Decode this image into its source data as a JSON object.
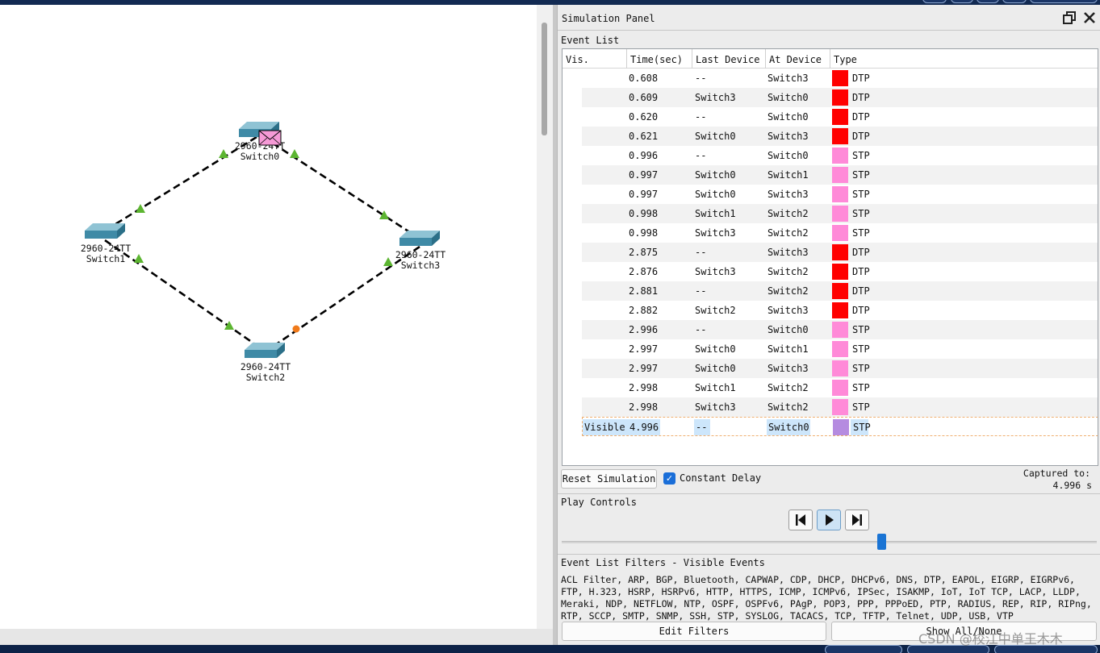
{
  "topology": {
    "devices": [
      {
        "model": "2960-24TT",
        "name": "Switch0"
      },
      {
        "model": "2960-24TT",
        "name": "Switch1"
      },
      {
        "model": "2960-24TT",
        "name": "Switch2"
      },
      {
        "model": "2960-24TT",
        "name": "Switch3"
      }
    ]
  },
  "panel": {
    "title": "Simulation Panel",
    "event_list_label": "Event List",
    "columns": [
      "Vis.",
      "Time(sec)",
      "Last Device",
      "At Device",
      "Type"
    ],
    "events": [
      {
        "time": "0.608",
        "last": "--",
        "at": "Switch3",
        "type": "DTP",
        "color": "#ff0000"
      },
      {
        "time": "0.609",
        "last": "Switch3",
        "at": "Switch0",
        "type": "DTP",
        "color": "#ff0000"
      },
      {
        "time": "0.620",
        "last": "--",
        "at": "Switch0",
        "type": "DTP",
        "color": "#ff0000"
      },
      {
        "time": "0.621",
        "last": "Switch0",
        "at": "Switch3",
        "type": "DTP",
        "color": "#ff0000"
      },
      {
        "time": "0.996",
        "last": "--",
        "at": "Switch0",
        "type": "STP",
        "color": "#ff8ad8"
      },
      {
        "time": "0.997",
        "last": "Switch0",
        "at": "Switch1",
        "type": "STP",
        "color": "#ff8ad8"
      },
      {
        "time": "0.997",
        "last": "Switch0",
        "at": "Switch3",
        "type": "STP",
        "color": "#ff8ad8"
      },
      {
        "time": "0.998",
        "last": "Switch1",
        "at": "Switch2",
        "type": "STP",
        "color": "#ff8ad8"
      },
      {
        "time": "0.998",
        "last": "Switch3",
        "at": "Switch2",
        "type": "STP",
        "color": "#ff8ad8"
      },
      {
        "time": "2.875",
        "last": "--",
        "at": "Switch3",
        "type": "DTP",
        "color": "#ff0000"
      },
      {
        "time": "2.876",
        "last": "Switch3",
        "at": "Switch2",
        "type": "DTP",
        "color": "#ff0000"
      },
      {
        "time": "2.881",
        "last": "--",
        "at": "Switch2",
        "type": "DTP",
        "color": "#ff0000"
      },
      {
        "time": "2.882",
        "last": "Switch2",
        "at": "Switch3",
        "type": "DTP",
        "color": "#ff0000"
      },
      {
        "time": "2.996",
        "last": "--",
        "at": "Switch0",
        "type": "STP",
        "color": "#ff8ad8"
      },
      {
        "time": "2.997",
        "last": "Switch0",
        "at": "Switch1",
        "type": "STP",
        "color": "#ff8ad8"
      },
      {
        "time": "2.997",
        "last": "Switch0",
        "at": "Switch3",
        "type": "STP",
        "color": "#ff8ad8"
      },
      {
        "time": "2.998",
        "last": "Switch1",
        "at": "Switch2",
        "type": "STP",
        "color": "#ff8ad8"
      },
      {
        "time": "2.998",
        "last": "Switch3",
        "at": "Switch2",
        "type": "STP",
        "color": "#ff8ad8"
      }
    ],
    "current_event": {
      "vis": "Visible",
      "time": "4.996",
      "last": "--",
      "at": "Switch0",
      "type": "STP",
      "color": "#b58be0"
    },
    "reset_button": "Reset Simulation",
    "constant_delay_label": "Constant Delay",
    "constant_delay_checked": true,
    "captured_label": "Captured to:",
    "captured_value": "4.996 s",
    "play_controls_label": "Play Controls",
    "filters_label": "Event List Filters - Visible Events",
    "filters_lines": [
      "ACL Filter, ARP, BGP, Bluetooth, CAPWAP, CDP, DHCP, DHCPv6, DNS, DTP, EAPOL, EIGRP, EIGRPv6,",
      "FTP, H.323, HSRP, HSRPv6, HTTP, HTTPS, ICMP, ICMPv6, IPSec, ISAKMP, IoT, IoT TCP, LACP, LLDP,",
      "Meraki, NDP, NETFLOW, NTP, OSPF, OSPFv6, PAgP, POP3, PPP, PPPoED, PTP, RADIUS, REP, RIP, RIPng,",
      "RTP, SCCP, SMTP, SNMP, SSH, STP, SYSLOG, TACACS, TCP, TFTP, Telnet, UDP, USB, VTP"
    ],
    "edit_filters_button": "Edit Filters",
    "show_all_button": "Show All/None"
  },
  "watermark": "CSDN @校江中单王木木",
  "colors": {
    "dtp": "#ff0000",
    "stp": "#ff8ad8",
    "selected_stp": "#b58be0",
    "link": "#000000",
    "link_up": "#5cb531",
    "link_blocking": "#f07a1a"
  }
}
